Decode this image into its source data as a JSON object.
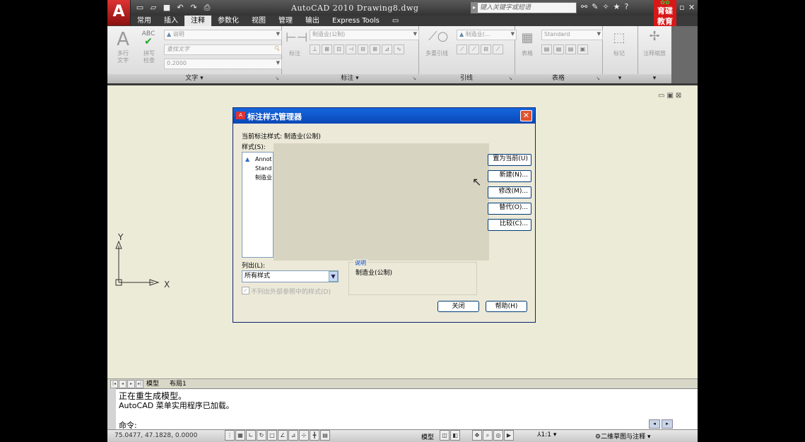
{
  "app": {
    "title": "AutoCAD 2010   Drawing8.dwg",
    "app_button": "A",
    "search_placeholder": "键入关键字或短语",
    "brand_logo": "育碟\n教育"
  },
  "quick_access": {
    "icons": [
      "new-icon",
      "open-icon",
      "save-icon",
      "undo-icon",
      "redo-icon",
      "plot-icon"
    ]
  },
  "ribbon_tabs": [
    "常用",
    "插入",
    "注释",
    "参数化",
    "视图",
    "管理",
    "输出",
    "Express Tools"
  ],
  "ribbon_active_tab": "注释",
  "ribbon": {
    "text_panel": {
      "multiline_text": "多行\n文字",
      "spell_check_top": "ABC",
      "spell_check": "拼写\n检查",
      "text_style": "说明",
      "find_text": "查找文字",
      "text_height": "0.2000",
      "footer": "文字"
    },
    "dim_panel": {
      "dimension": "标注",
      "dim_style": "制造业(公制)",
      "footer": "标注"
    },
    "leader_panel": {
      "multileader": "多重引线",
      "leader_style": "制造业(…",
      "footer": "引线"
    },
    "table_panel": {
      "table": "表格",
      "table_style": "Standard",
      "footer": "表格"
    },
    "markup_panel": {
      "label": "标记"
    },
    "annotation_scale_panel": {
      "label": "注释缩放"
    }
  },
  "ucs": {
    "x": "X",
    "y": "Y"
  },
  "layout_tabs": {
    "model": "模型",
    "layout1": "布局1"
  },
  "command": {
    "line1": "正在重生成模型。",
    "line2": "AutoCAD 菜单实用程序已加载。",
    "prompt": "命令:"
  },
  "status": {
    "coords": "75.0477, 47.1828, 0.0000",
    "model": "模型",
    "scale": "1:1",
    "workspace": "二维草图与注释"
  },
  "dialog": {
    "title": "标注样式管理器",
    "current_style": "当前标注样式: 制造业(公制)",
    "styles_label": "样式(S):",
    "styles": [
      "Annot",
      "Stand",
      "制造业"
    ],
    "buttons": [
      "置为当前(U)",
      "新建(N)...",
      "修改(M)...",
      "替代(O)...",
      "比较(C)..."
    ],
    "list_label": "列出(L):",
    "list_value": "所有样式",
    "xref_label": "不列出外部参照中的样式(D)",
    "description_title": "说明",
    "description_text": "制造业(公制)",
    "close": "关闭",
    "help": "帮助(H)"
  }
}
